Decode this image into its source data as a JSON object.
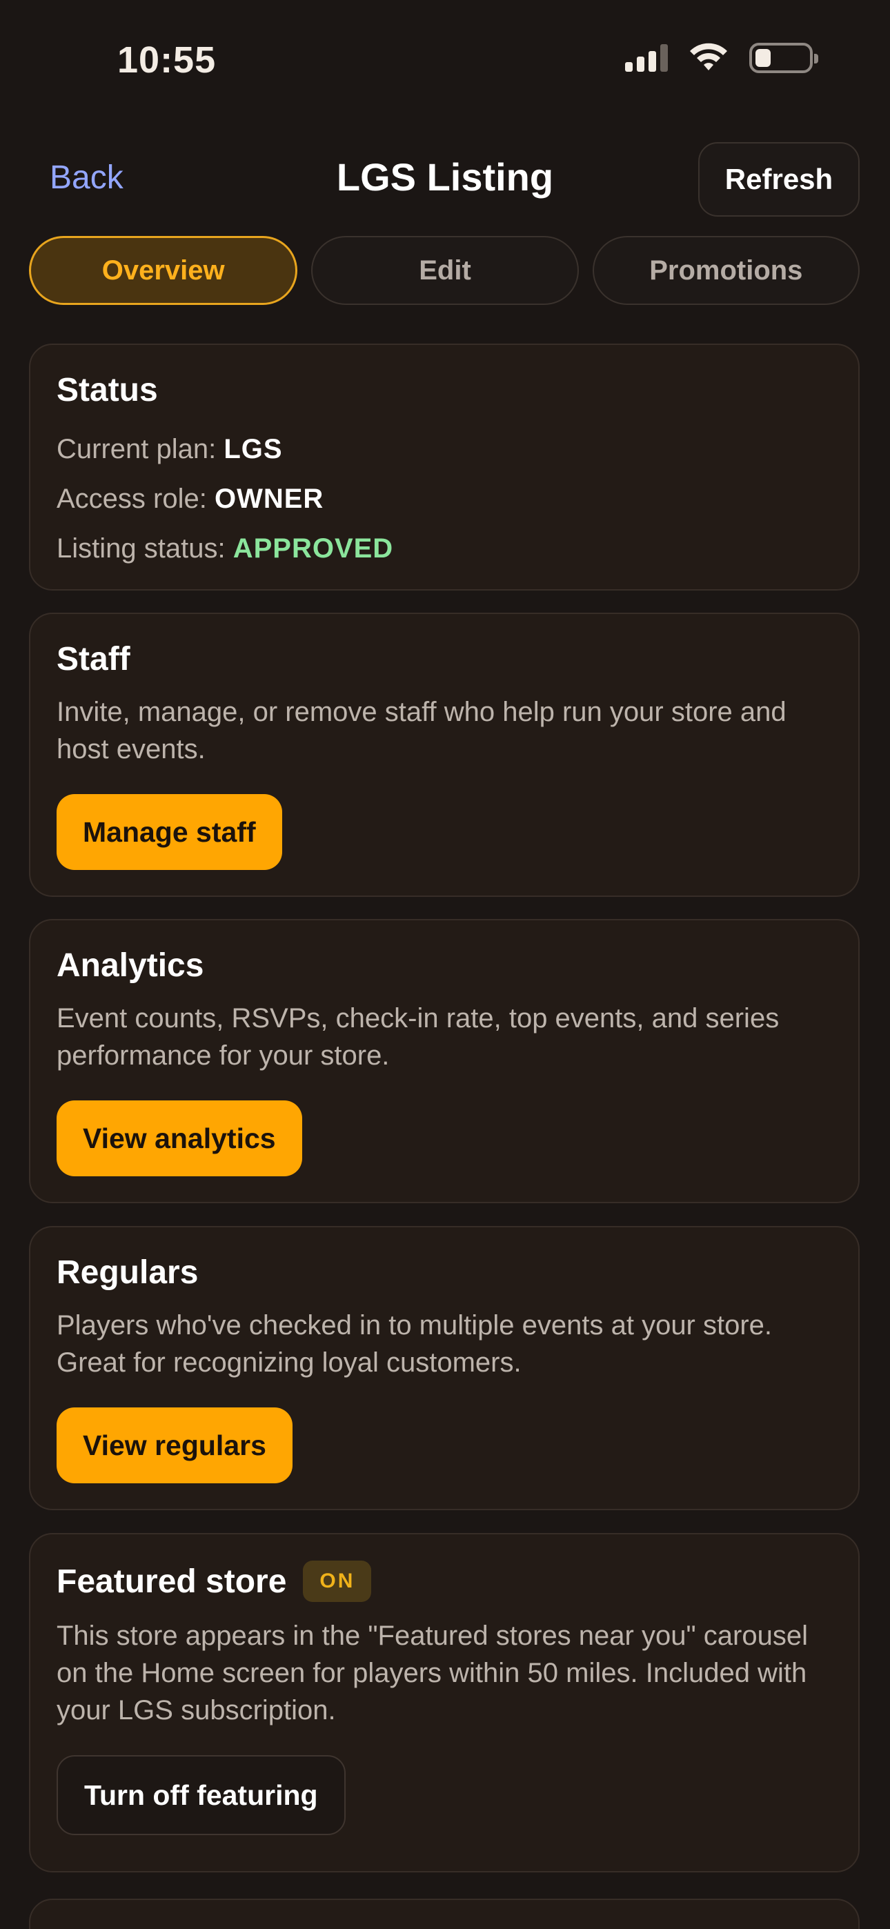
{
  "status_bar": {
    "time": "10:55"
  },
  "header": {
    "back_label": "Back",
    "title": "LGS Listing",
    "refresh_label": "Refresh"
  },
  "tabs": [
    {
      "label": "Overview",
      "active": true
    },
    {
      "label": "Edit",
      "active": false
    },
    {
      "label": "Promotions",
      "active": false
    }
  ],
  "status_card": {
    "title": "Status",
    "plan_label": "Current plan:",
    "plan_value": "LGS",
    "role_label": "Access role:",
    "role_value": "OWNER",
    "listing_label": "Listing status:",
    "listing_value": "APPROVED"
  },
  "staff_card": {
    "title": "Staff",
    "description": "Invite, manage, or remove staff who help run your store and host events.",
    "button": "Manage staff"
  },
  "analytics_card": {
    "title": "Analytics",
    "description": "Event counts, RSVPs, check-in rate, top events, and series performance for your store.",
    "button": "View analytics"
  },
  "regulars_card": {
    "title": "Regulars",
    "description": "Players who've checked in to multiple events at your store. Great for recognizing loyal customers.",
    "button": "View regulars"
  },
  "featured_card": {
    "title": "Featured store",
    "badge": "ON",
    "description": "This store appears in the \"Featured stores near you\" carousel on the Home screen for players within 50 miles. Included with your LGS subscription.",
    "button": "Turn off featuring"
  },
  "colors": {
    "background": "#1b1614",
    "card": "#231b16",
    "accent": "#ffa602",
    "link": "#93a6ff",
    "approved": "#8be59c"
  },
  "icons": [
    "signal-icon",
    "wifi-icon",
    "battery-icon"
  ]
}
